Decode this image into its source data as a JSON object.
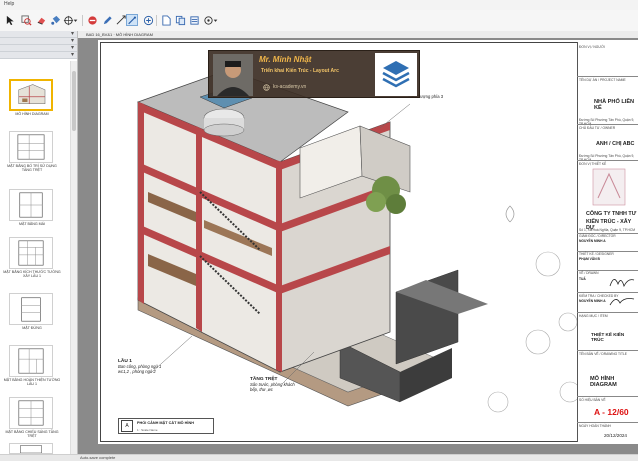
{
  "menu": {
    "label": "Help"
  },
  "tabs": {
    "active": "BAD 16_BV&1 · MÔ HÌNH DIAGRAM"
  },
  "pages_panel": {
    "thumbnails": [
      {
        "label": "MÔ HÌNH DIAGRAM"
      },
      {
        "label": "MẶT BẰNG BỐ TRÍ SỬ DỤNG TẦNG TRỆT"
      },
      {
        "label": "MẶT BẰNG MÁI"
      },
      {
        "label": "MẶT BẰNG KÍCH THƯỚC TƯỜNG XÂY LẦU 1"
      },
      {
        "label": "MẶT ĐỨNG"
      },
      {
        "label": "MẶT BẰNG HOÀN THIỆN TƯỜNG LẦU 1"
      },
      {
        "label": "MẶT BẰNG CHIẾU SÁNG TẦNG TRỆT"
      },
      {
        "label": ""
      }
    ]
  },
  "banner": {
    "name": "Mr. Minh Nhật",
    "role": "Triển khai Kiến Trúc - Layout Arc",
    "website": "ks-academy.vn"
  },
  "annotations": {
    "top_note": "Sân thượng phía 3",
    "lau1_title": "LẦU 1",
    "lau1_text1": "Ban công, phòng ngủ 1",
    "lau1_text2": "wc1,2 , phòng ngủ 2",
    "tret_title": "TẦNG TRỆT",
    "tret_text1": "Sân trước, phòng khách",
    "tret_text2": "bếp, thư ,wc",
    "legend_id": "A",
    "legend_title": "PHỐI CẢNH MẶT CẮT MÔ HÌNH",
    "legend_scale": "1 : Scale Name"
  },
  "titleblock": {
    "hdr": "ĐƠN VỊ / NGƯỜI",
    "project_lbl": "TÊN DỰ ÁN / PROJECT NAME",
    "project": "NHÀ PHỐ LIÊN KẾ",
    "address": "Đường Số Phường Tân Phú, Quận 9, TP.HCM",
    "owner_lbl": "CHỦ ĐẦU TƯ / OWNER",
    "owner": "ANH / CHỊ ABC",
    "owner_addr": "Đường Số Phường Tân Phú, Quận 9, TP.HCM",
    "design_lbl": "ĐƠN VỊ THIẾT KẾ",
    "company1": "CÔNG TY TNHH TƯ",
    "company2": "KIẾN TRÚC - XÂY DỰ",
    "company_addr": "Số 1, Xã Hoà Nghĩa, Quận 9, TP.HCM",
    "director_lbl": "GIÁM ĐỐC / DIRECTOR",
    "director": "NGUYỄN MINH A",
    "designer_lbl": "THIẾT KẾ / DESIGNER",
    "designer": "PHẠM VĂN B",
    "drawn_lbl": "VẼ / DRAWN",
    "drawn": "TUẤ",
    "checked_lbl": "KIỂM TRA / CHECKED BY",
    "checked": "NGUYỄN MINH A",
    "category_lbl": "HẠNG MỤC / ITEM",
    "category": "THIẾT KẾ KIẾN TRÚC",
    "drawing_lbl": "TÊN BẢN VẼ / DRAWING TITLE",
    "drawing": "MÔ HÌNH DIAGRAM",
    "sheetno_lbl": "SỐ HIỆU BẢN VẼ",
    "sheetno": "A - 12/60",
    "date_lbl": "NGÀY HOÀN THÀNH",
    "date": "20/12/2024"
  },
  "status": {
    "text": "Auto-save complete"
  },
  "colors": {
    "accent_selected": "#f0b400",
    "section_cut": "#b8474a",
    "sheet_number": "#dd1111"
  }
}
